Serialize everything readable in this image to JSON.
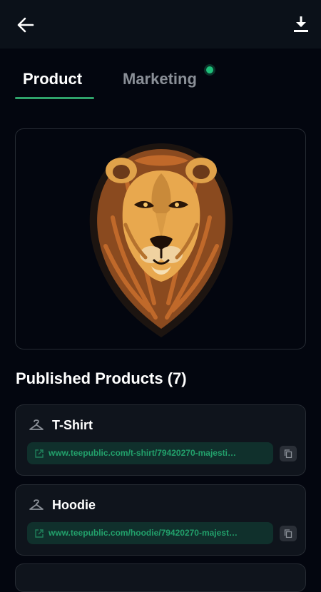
{
  "header": {
    "back_icon": "arrow-left-icon",
    "download_icon": "download-icon"
  },
  "tabs": [
    {
      "label": "Product",
      "active": true
    },
    {
      "label": "Marketing",
      "active": false,
      "has_notification_dot": true
    }
  ],
  "colors": {
    "background": "#03060f",
    "accent": "#2fa36b",
    "link_text": "#22a06b",
    "notification": "#1fbf7a"
  },
  "logo": {
    "icon": "lion-head-logo"
  },
  "published": {
    "title": "Published Products (7)",
    "products": [
      {
        "name": "T-Shirt",
        "url": "www.teepublic.com/t-shirt/79420270-majesti…",
        "icon": "hanger-icon"
      },
      {
        "name": "Hoodie",
        "url": "www.teepublic.com/hoodie/79420270-majest…",
        "icon": "hanger-icon"
      }
    ]
  }
}
